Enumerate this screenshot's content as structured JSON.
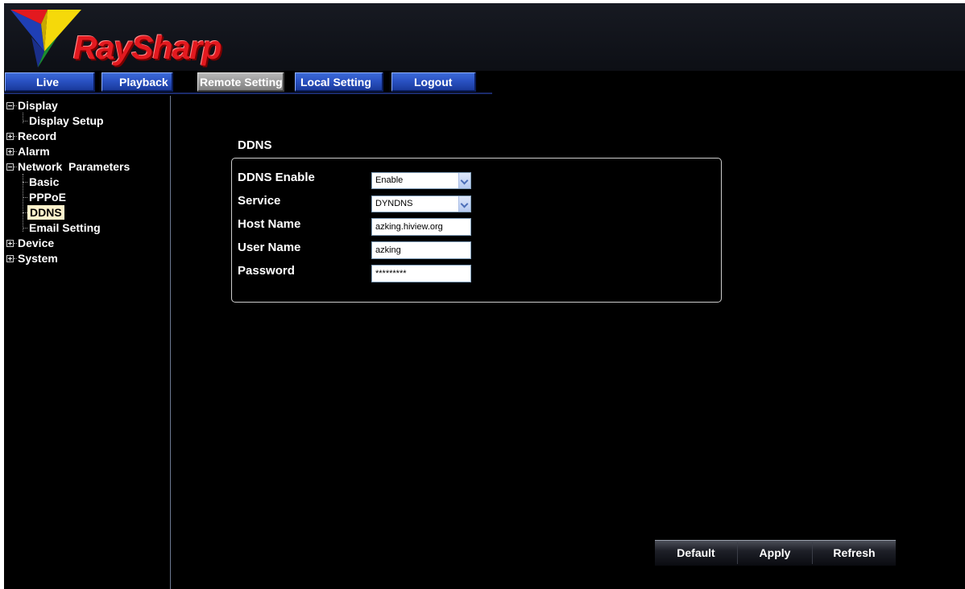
{
  "brand": {
    "name": "RaySharp"
  },
  "nav": {
    "tabs": [
      {
        "label": "Live"
      },
      {
        "label": "Playback"
      },
      {
        "label": "Remote Setting",
        "active": true
      },
      {
        "label": "Local Setting"
      },
      {
        "label": "Logout"
      }
    ]
  },
  "sidebar": {
    "tree": [
      {
        "label": "Display",
        "expanded": true,
        "children": [
          {
            "label": "Display Setup"
          }
        ]
      },
      {
        "label": "Record",
        "expanded": false
      },
      {
        "label": "Alarm",
        "expanded": false
      },
      {
        "label": "Network  Parameters",
        "expanded": true,
        "children": [
          {
            "label": "Basic"
          },
          {
            "label": "PPPoE"
          },
          {
            "label": "DDNS",
            "selected": true
          },
          {
            "label": "Email Setting"
          }
        ]
      },
      {
        "label": "Device",
        "expanded": false
      },
      {
        "label": "System",
        "expanded": false
      }
    ]
  },
  "ddns": {
    "title": "DDNS",
    "fields": {
      "enable": {
        "label": "DDNS Enable",
        "value": "Enable"
      },
      "service": {
        "label": "Service",
        "value": "DYNDNS"
      },
      "host_name": {
        "label": "Host Name",
        "value": "azking.hiview.org"
      },
      "user_name": {
        "label": "User Name",
        "value": "azking"
      },
      "password": {
        "label": "Password",
        "value": "*********"
      }
    }
  },
  "actions": {
    "default_label": "Default",
    "apply_label": "Apply",
    "refresh_label": "Refresh"
  },
  "colors": {
    "background": "#000000",
    "nav_blue": "#2a52c3",
    "nav_active": "#9a9a9a",
    "brand_red": "#e3191f",
    "selected_bg": "#fff2cc"
  }
}
